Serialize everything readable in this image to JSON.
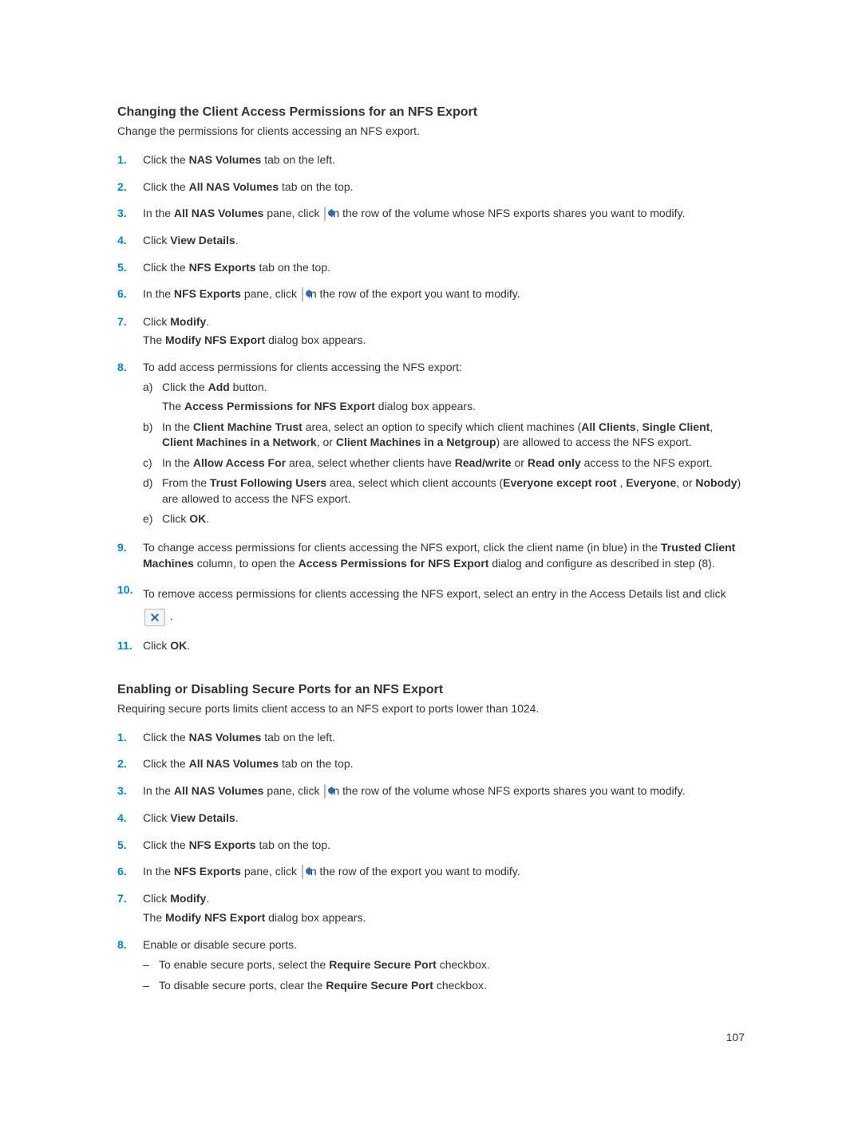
{
  "section1": {
    "heading": "Changing the Client Access Permissions for an NFS Export",
    "subtitle": "Change the permissions for clients accessing an NFS export.",
    "steps": [
      {
        "n": "1.",
        "parts": [
          "Click the ",
          "NAS Volumes",
          " tab on the left."
        ]
      },
      {
        "n": "2.",
        "parts": [
          "Click the ",
          "All NAS Volumes",
          " tab on the top."
        ]
      },
      {
        "n": "3.",
        "pre": "In the ",
        "bold": "All NAS Volumes",
        "mid": " pane, click ",
        "post": " in the row of the volume whose NFS exports shares you want to modify.",
        "icon": "settings"
      },
      {
        "n": "4.",
        "parts": [
          "Click ",
          "View Details",
          "."
        ]
      },
      {
        "n": "5.",
        "parts": [
          "Click the ",
          "NFS Exports",
          " tab on the top."
        ]
      },
      {
        "n": "6.",
        "pre": "In the ",
        "bold": "NFS Exports",
        "mid": " pane, click ",
        "post": " in the row of the export you want to modify.",
        "icon": "settings"
      },
      {
        "n": "7.",
        "parts": [
          "Click ",
          "Modify",
          "."
        ],
        "after": "The <b>Modify NFS Export</b> dialog box appears."
      },
      {
        "n": "8.",
        "intro": "To add access permissions for clients accessing the NFS export:",
        "sub": [
          {
            "k": "a)",
            "t": "Click the <b>Add</b> button.",
            "after": "The <b>Access Permissions for NFS Export</b> dialog box appears."
          },
          {
            "k": "b)",
            "t": "In the <b>Client Machine Trust</b> area, select an option to specify which client machines (<b>All Clients</b>, <b>Single Client</b>, <b>Client Machines in a Network</b>, or <b>Client Machines in a Netgroup</b>) are allowed to access the NFS export."
          },
          {
            "k": "c)",
            "t": "In the <b>Allow Access For</b> area, select whether clients have <b>Read/write</b> or <b>Read only</b> access to the NFS export."
          },
          {
            "k": "d)",
            "t": "From the <b>Trust Following Users</b> area, select which client accounts (<b>Everyone except root</b> , <b>Everyone</b>, or <b>Nobody</b>) are allowed to access the NFS export."
          },
          {
            "k": "e)",
            "t": "Click <b>OK</b>."
          }
        ]
      },
      {
        "n": "9.",
        "html": "To change access permissions for clients accessing the NFS export, click the client name (in blue) in the <b>Trusted Client Machines</b> column, to open the <b>Access Permissions for NFS Export</b> dialog and configure as described in step (8)."
      },
      {
        "n": "10.",
        "pre2": "To remove access permissions for clients accessing the NFS export, select an entry in the Access Details list and click ",
        "icon": "close",
        "post2": " ."
      },
      {
        "n": "11.",
        "parts": [
          "Click ",
          "OK",
          "."
        ]
      }
    ]
  },
  "section2": {
    "heading": "Enabling or Disabling Secure Ports for an NFS Export",
    "subtitle": "Requiring secure ports limits client access to an NFS export to ports lower than 1024.",
    "steps": [
      {
        "n": "1.",
        "parts": [
          "Click the ",
          "NAS Volumes",
          " tab on the left."
        ]
      },
      {
        "n": "2.",
        "parts": [
          "Click the ",
          "All NAS Volumes",
          " tab on the top."
        ]
      },
      {
        "n": "3.",
        "pre": "In the ",
        "bold": "All NAS Volumes",
        "mid": " pane, click ",
        "post": " in the row of the volume whose NFS exports shares you want to modify.",
        "icon": "settings"
      },
      {
        "n": "4.",
        "parts": [
          "Click ",
          "View Details",
          "."
        ]
      },
      {
        "n": "5.",
        "parts": [
          "Click the ",
          "NFS Exports",
          " tab on the top."
        ]
      },
      {
        "n": "6.",
        "pre": "In the ",
        "bold": "NFS Exports",
        "mid": " pane, click ",
        "post": " in the row of the export you want to modify.",
        "icon": "settings"
      },
      {
        "n": "7.",
        "parts": [
          "Click ",
          "Modify",
          "."
        ],
        "after": "The <b>Modify NFS Export</b> dialog box appears."
      },
      {
        "n": "8.",
        "intro": "Enable or disable secure ports.",
        "dash": [
          "To enable secure ports, select the <b>Require Secure Port</b> checkbox.",
          "To disable secure ports, clear the <b>Require Secure Port</b> checkbox."
        ]
      }
    ]
  },
  "page": "107"
}
